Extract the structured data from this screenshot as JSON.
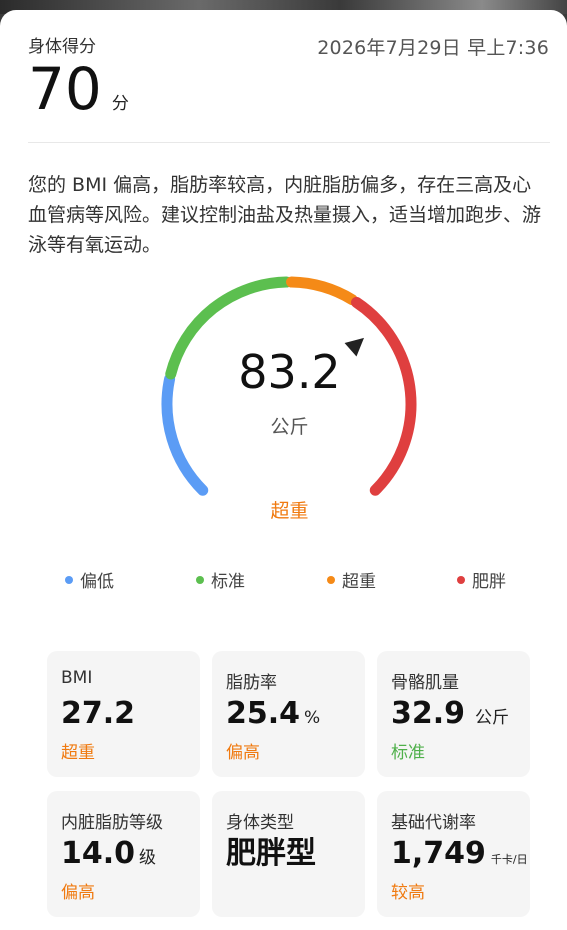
{
  "score": {
    "label": "身体得分",
    "datetime": "2026年7月29日 早上7:36",
    "value": "70",
    "unit": "分"
  },
  "advice": "您的 BMI 偏高，脂肪率较高，内脏脂肪偏多，存在三高及心血管病等风险。建议控制油盐及热量摄入，适当增加跑步、游泳等有氧运动。",
  "gauge": {
    "value": "83.2",
    "unit": "公斤",
    "status": "超重",
    "status_color": "#f07a10",
    "segments": [
      {
        "label": "偏低",
        "color": "#5b9cf5"
      },
      {
        "label": "标准",
        "color": "#5cbf4f"
      },
      {
        "label": "超重",
        "color": "#f58a17"
      },
      {
        "label": "肥胖",
        "color": "#df3f3f"
      }
    ],
    "indicator_fraction": 0.68
  },
  "metrics": [
    {
      "label": "BMI",
      "value": "27.2",
      "unit": "",
      "status": "超重",
      "status_color": "#f07a10"
    },
    {
      "label": "脂肪率",
      "value": "25.4",
      "unit": "%",
      "status": "偏高",
      "status_color": "#f07a10"
    },
    {
      "label": "骨骼肌量",
      "value": "32.9",
      "unit": "公斤",
      "status": "标准",
      "status_color": "#4fb04a"
    },
    {
      "label": "内脏脂肪等级",
      "value": "14.0",
      "unit": "级",
      "status": "偏高",
      "status_color": "#f07a10"
    },
    {
      "label": "身体类型",
      "value": "肥胖型",
      "unit": "",
      "status": "",
      "status_color": "#333333"
    },
    {
      "label": "基础代谢率",
      "value": "1,749",
      "unit": "千卡/日",
      "status": "较高",
      "status_color": "#f07a10"
    }
  ]
}
